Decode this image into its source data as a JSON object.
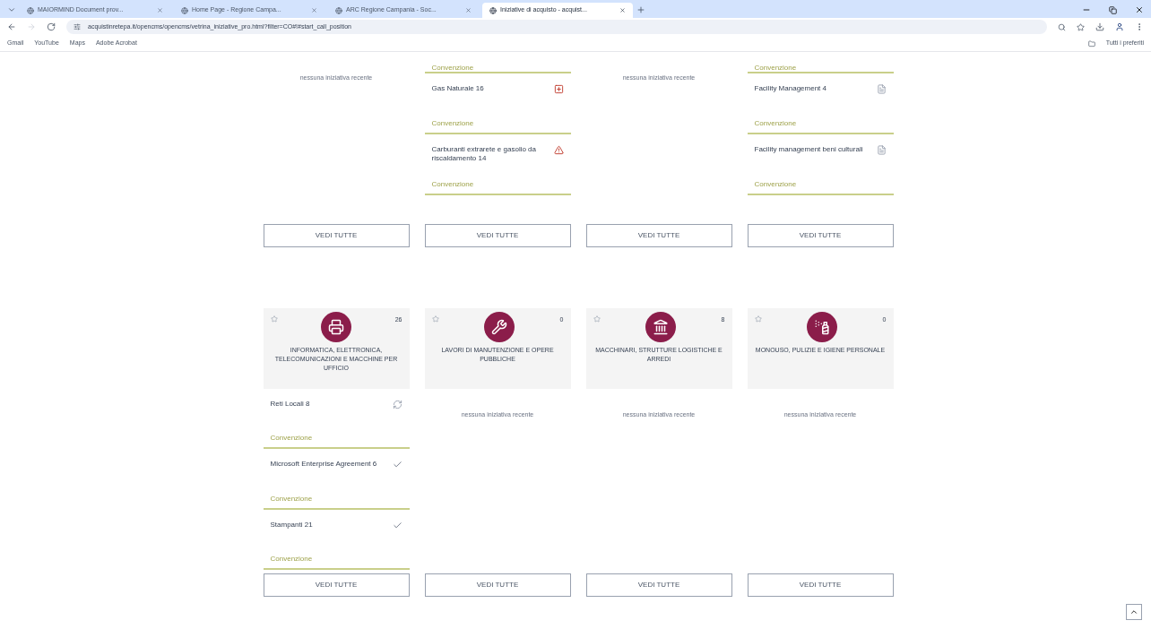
{
  "browser": {
    "tabs": [
      {
        "title": "MAIORMIND Document prov...",
        "selected": false
      },
      {
        "title": "Home Page - Regione Campa...",
        "selected": false
      },
      {
        "title": "ARC Regione Campania - Soc...",
        "selected": false
      },
      {
        "title": "Iniziative di acquisto - acquist...",
        "selected": true
      }
    ],
    "url": "acquistinretepa.it/opencms/opencms/vetrina_iniziative_pro.html?filter=CO#!#start_call_position",
    "bookmarks": [
      "Gmail",
      "YouTube",
      "Maps",
      "Adobe Acrobat"
    ],
    "all_bookmarks": "Tutti i preferiti"
  },
  "top_row": [
    {
      "empty_text": "nessuna iniziativa recente",
      "button": "VEDI TUTTE"
    },
    {
      "items": [
        {
          "label": "Convenzione"
        },
        {
          "name": "Gas Naturale 16",
          "kind": "plus",
          "label": "Convenzione"
        },
        {
          "name": "Carburanti extrarete e gasolio da riscaldamento 14",
          "kind": "warning",
          "label": "Convenzione"
        }
      ],
      "button": "VEDI TUTTE"
    },
    {
      "empty_text": "nessuna iniziativa recente",
      "button": "VEDI TUTTE"
    },
    {
      "items": [
        {
          "label": "Convenzione"
        },
        {
          "name": "Facility Management 4",
          "kind": "doc",
          "label": "Convenzione"
        },
        {
          "name": "Facility management beni culturali",
          "kind": "doc",
          "label": "Convenzione"
        }
      ],
      "button": "VEDI TUTTE"
    }
  ],
  "categories": [
    {
      "kind": "printer",
      "count": "26",
      "title": "INFORMATICA, ELETTRONICA, TELECOMUNICAZIONI E MACCHINE PER UFFICIO",
      "items": [
        {
          "name": "Reti Locali 8",
          "kind": "refresh",
          "label": "Convenzione"
        },
        {
          "name": "Microsoft Enterprise Agreement 6",
          "kind": "check",
          "label": "Convenzione"
        },
        {
          "name": "Stampanti 21",
          "kind": "check",
          "label": "Convenzione"
        }
      ],
      "button": "VEDI TUTTE"
    },
    {
      "kind": "tools",
      "count": "0",
      "title": "LAVORI DI MANUTENZIONE E OPERE PUBBLICHE",
      "empty_text": "nessuna iniziativa recente",
      "button": "VEDI TUTTE"
    },
    {
      "kind": "building",
      "count": "8",
      "title": "MACCHINARI, STRUTTURE LOGISTICHE E ARREDI",
      "empty_text": "nessuna iniziativa recente",
      "button": "VEDI TUTTE"
    },
    {
      "kind": "hygiene",
      "count": "0",
      "title": "MONOUSO, PULIZIE E IGIENE PERSONALE",
      "empty_text": "nessuna iniziativa recente",
      "button": "VEDI TUTTE"
    }
  ]
}
